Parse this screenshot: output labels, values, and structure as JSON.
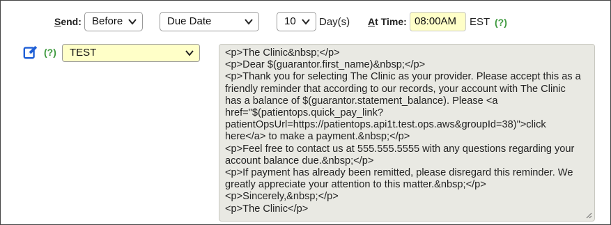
{
  "send": {
    "label_prefix": "S",
    "label_rest": "end:",
    "timing_value": "Before",
    "field_value": "Due Date",
    "days_value": "10",
    "days_unit": "Day(s)"
  },
  "at_time": {
    "label_prefix": "A",
    "label_rest": "t Time:",
    "value": "08:00AM",
    "timezone": "EST",
    "help": "(?)"
  },
  "template": {
    "help": "(?)",
    "selected": "TEST"
  },
  "message_body_lines": [
    "<p>The Clinic&nbsp;</p>",
    "<p>Dear $(guarantor.first_name)&nbsp;</p>",
    "<p>Thank you for selecting The Clinic as your provider. Please accept this as a",
    "friendly reminder that according to our records, your account with The Clinic",
    "has a balance of $(guarantor.statement_balance). Please <a",
    "href=\"$(patientops.quick_pay_link?",
    "patientOpsUrl=https://patientops.api1t.test.ops.aws&groupId=38)\">click",
    "here</a> to make a payment.&nbsp;</p>",
    "<p>Feel free to contact us at 555.555.5555 with any questions regarding your",
    "account balance due.&nbsp;</p>",
    "<p>If payment has already been remitted, please disregard this reminder. We",
    "greatly appreciate your attention to this matter.&nbsp;</p>",
    "<p>Sincerely,&nbsp;</p>",
    "<p>The Clinic</p>"
  ],
  "icons": {
    "edit": "edit-icon",
    "chevron": "chevron-down-icon",
    "resize": "resize-grip-icon"
  },
  "colors": {
    "input_highlight": "#ffffc8",
    "help_green": "#3e9a3e",
    "edit_blue": "#1f5fd6",
    "textarea_bg": "#e9e9e3"
  }
}
